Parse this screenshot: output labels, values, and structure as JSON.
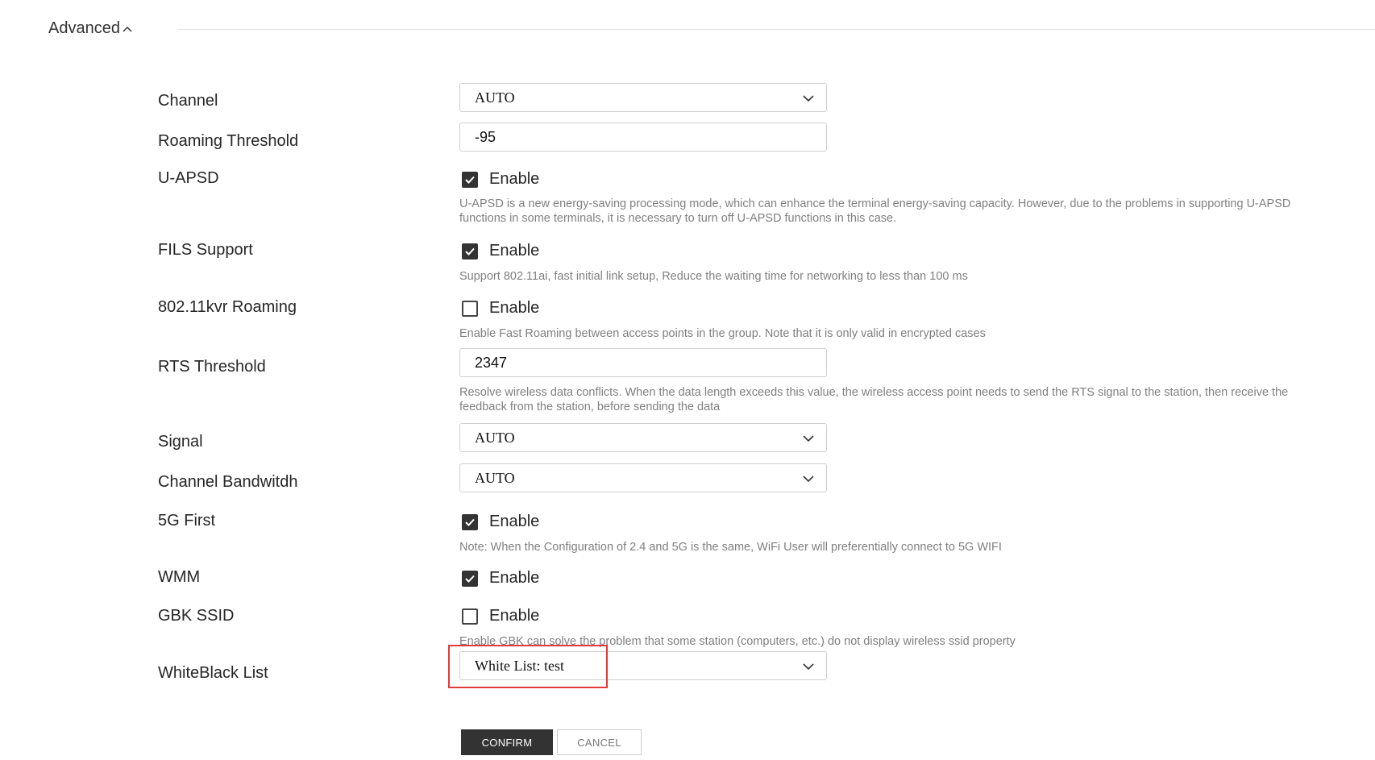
{
  "section": {
    "title": "Advanced"
  },
  "fields": {
    "channel": {
      "label": "Channel",
      "value": "AUTO"
    },
    "roaming_threshold": {
      "label": "Roaming Threshold",
      "value": "-95"
    },
    "uapsd": {
      "label": "U-APSD",
      "checked": true,
      "option": "Enable",
      "help": "U-APSD is a new energy-saving processing mode, which can enhance the terminal energy-saving capacity. However, due to the problems in supporting U-APSD functions in some terminals, it is necessary to turn off U-APSD functions in this case."
    },
    "fils": {
      "label": "FILS Support",
      "checked": true,
      "option": "Enable",
      "help": "Support 802.11ai, fast initial link setup, Reduce the waiting time for networking to less than 100 ms"
    },
    "kvr": {
      "label": "802.11kvr Roaming",
      "checked": false,
      "option": "Enable",
      "help": "Enable Fast Roaming between access points in the group. Note that it is only valid in encrypted cases"
    },
    "rts": {
      "label": "RTS Threshold",
      "value": "2347",
      "help": "Resolve wireless data conflicts. When the data length exceeds this value, the wireless access point needs to send the RTS signal to the station, then receive the feedback from the station, before sending the data"
    },
    "signal": {
      "label": "Signal",
      "value": "AUTO"
    },
    "bandwidth": {
      "label": "Channel Bandwitdh",
      "value": "AUTO"
    },
    "first5g": {
      "label": "5G First",
      "checked": true,
      "option": "Enable",
      "help": "Note: When the Configuration of 2.4 and 5G is the same, WiFi User will preferentially connect to 5G WIFI"
    },
    "wmm": {
      "label": "WMM",
      "checked": true,
      "option": "Enable"
    },
    "gbk": {
      "label": "GBK SSID",
      "checked": false,
      "option": "Enable",
      "help": "Enable GBK can solve the problem that some station (computers, etc.) do not display wireless ssid property"
    },
    "whiteblack": {
      "label": "WhiteBlack List",
      "value": "White List: test"
    }
  },
  "buttons": {
    "confirm": "CONFIRM",
    "cancel": "CANCEL"
  },
  "colors": {
    "accent": "#333333",
    "highlight": "#e03a3a",
    "help_text": "#808080",
    "border": "#cfcfcf"
  }
}
